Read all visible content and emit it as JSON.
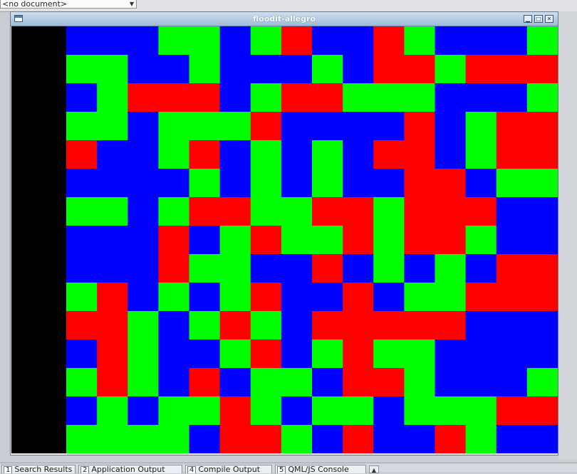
{
  "ide": {
    "document_select_value": "<no document>",
    "bottom_tabs": [
      {
        "num": "1",
        "label": "Search Results"
      },
      {
        "num": "2",
        "label": "Application Output"
      },
      {
        "num": "4",
        "label": "Compile Output"
      },
      {
        "num": "5",
        "label": "QML/JS Console"
      }
    ]
  },
  "window": {
    "title": "floodit-allegro"
  },
  "palette": {
    "B": "#0000ff",
    "G": "#00ff00",
    "R": "#ff0000",
    "panel": "#000000"
  },
  "board": {
    "rows": 15,
    "cols": 16,
    "cells": [
      "BBBGGBGRBBRGBBBG",
      "GGBBGBBBGBRRGRRR",
      "BGRRRBGRRGGGBBBG",
      "GGBGGGRBBBBRBGRR",
      "RBBGRBGBGBRRBGRR",
      "BBBBGBGBGBBRRBGG",
      "GGBGRRGGRRGRRRBB",
      "BBBRBGRGGRGRRGBB",
      "BBBRGGBBRBGBGBRR",
      "GRBGBGRBBRBGGRRR",
      "RRGBGRGBRRRRRBBB",
      "BRGBBGRBGRGGBBBB",
      "GRGBRBGGBRRGBBBG",
      "BGBGGRGBGGBGGGRR",
      "GGGGBRRGBRBBRGBB"
    ]
  }
}
